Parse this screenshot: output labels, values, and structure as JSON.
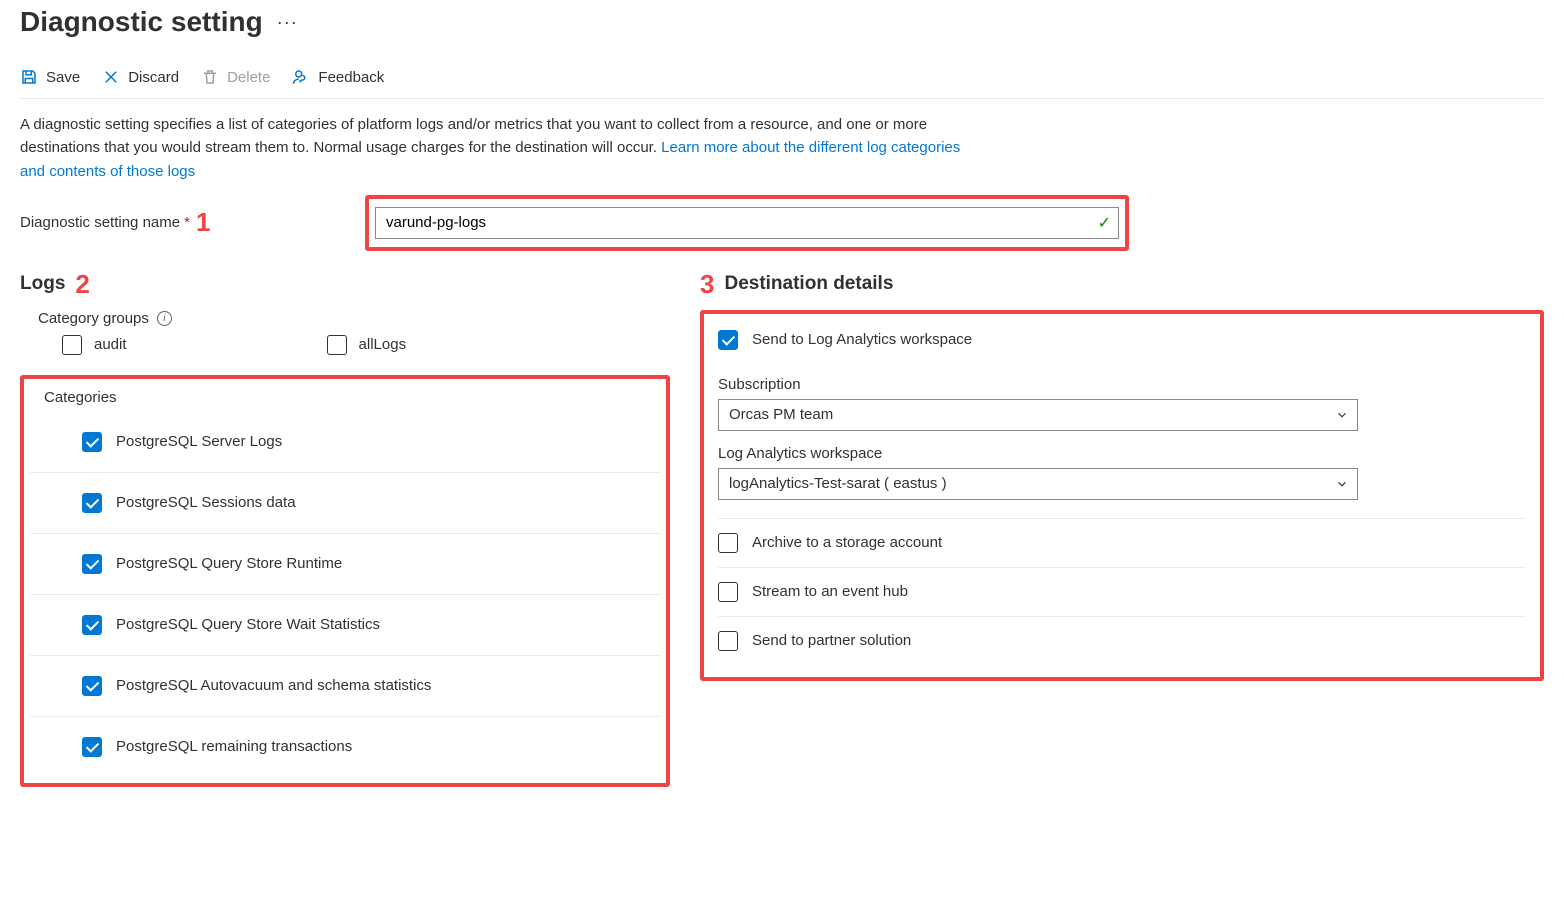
{
  "pageTitle": "Diagnostic setting",
  "toolbar": {
    "save": "Save",
    "discard": "Discard",
    "delete": "Delete",
    "feedback": "Feedback"
  },
  "description": {
    "part1": "A diagnostic setting specifies a list of categories of platform logs and/or metrics that you want to collect from a resource, and one or more destinations that you would stream them to. Normal usage charges for the destination will occur. ",
    "link": "Learn more about the different log categories and contents of those logs"
  },
  "nameField": {
    "label": "Diagnostic setting name",
    "value": "varund-pg-logs"
  },
  "callouts": {
    "one": "1",
    "two": "2",
    "three": "3"
  },
  "logs": {
    "heading": "Logs",
    "categoryGroupsLabel": "Category groups",
    "groups": {
      "audit": "audit",
      "allLogs": "allLogs"
    },
    "categoriesLabel": "Categories",
    "categories": [
      "PostgreSQL Server Logs",
      "PostgreSQL Sessions data",
      "PostgreSQL Query Store Runtime",
      "PostgreSQL Query Store Wait Statistics",
      "PostgreSQL Autovacuum and schema statistics",
      "PostgreSQL remaining transactions"
    ]
  },
  "destination": {
    "heading": "Destination details",
    "sendLA": "Send to Log Analytics workspace",
    "subscriptionLabel": "Subscription",
    "subscriptionValue": "Orcas PM team",
    "workspaceLabel": "Log Analytics workspace",
    "workspaceValue": "logAnalytics-Test-sarat ( eastus )",
    "archive": "Archive to a storage account",
    "stream": "Stream to an event hub",
    "partner": "Send to partner solution"
  }
}
